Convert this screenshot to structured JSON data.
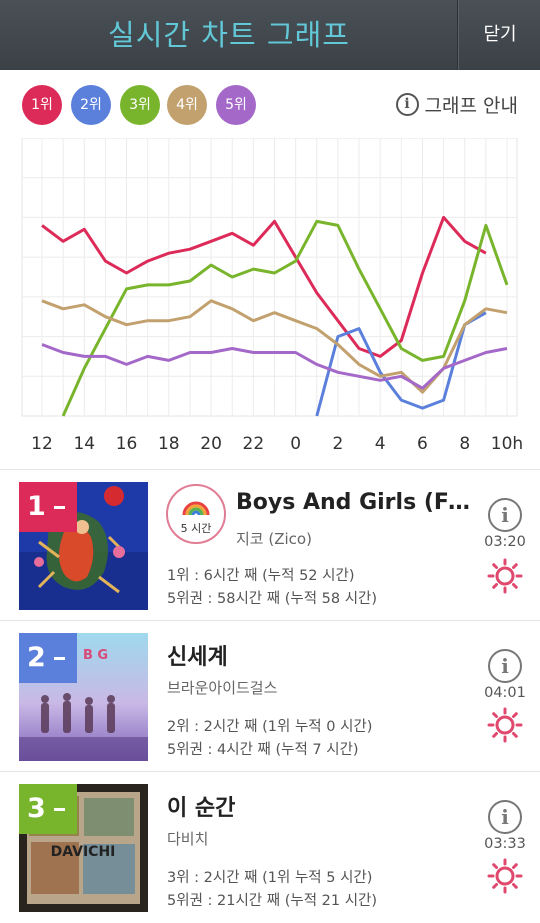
{
  "header": {
    "title": "실시간 차트 그래프",
    "close_label": "닫기"
  },
  "legend": {
    "items": [
      {
        "label": "1위",
        "color": "#dd2b59"
      },
      {
        "label": "2위",
        "color": "#5b80dc"
      },
      {
        "label": "3위",
        "color": "#79b52c"
      },
      {
        "label": "4위",
        "color": "#c2a16e"
      },
      {
        "label": "5위",
        "color": "#a468c8"
      }
    ],
    "guide_label": "그래프 안내"
  },
  "chart_data": {
    "type": "line",
    "x": [
      "12",
      "13",
      "14",
      "15",
      "16",
      "17",
      "18",
      "19",
      "20",
      "21",
      "22",
      "23",
      "0",
      "1",
      "2",
      "3",
      "4",
      "5",
      "6",
      "7",
      "8",
      "9",
      "10h"
    ],
    "tick_labels": [
      "12",
      "14",
      "16",
      "18",
      "20",
      "22",
      "0",
      "2",
      "4",
      "6",
      "8",
      "10h"
    ],
    "ylim": [
      7,
      0
    ],
    "grid": true,
    "series": [
      {
        "rank": 1,
        "color": "#dd2b59",
        "values": [
          2.2,
          2.6,
          2.3,
          3.1,
          3.4,
          3.1,
          2.9,
          2.8,
          2.6,
          2.4,
          2.7,
          2.1,
          3.0,
          3.9,
          4.6,
          5.3,
          5.5,
          5.1,
          3.4,
          2.0,
          2.6,
          2.9,
          null
        ]
      },
      {
        "rank": 2,
        "color": "#5b80dc",
        "values": [
          null,
          null,
          null,
          null,
          null,
          null,
          null,
          null,
          null,
          null,
          null,
          null,
          null,
          7.0,
          5.0,
          4.8,
          5.9,
          6.6,
          6.8,
          6.6,
          4.7,
          4.4,
          null
        ]
      },
      {
        "rank": 3,
        "color": "#79b52c",
        "values": [
          null,
          7.0,
          5.8,
          4.8,
          3.8,
          3.7,
          3.7,
          3.6,
          3.2,
          3.5,
          3.3,
          3.4,
          3.1,
          2.1,
          2.2,
          3.3,
          4.3,
          5.3,
          5.6,
          5.5,
          4.1,
          2.2,
          3.7
        ]
      },
      {
        "rank": 4,
        "color": "#c2a16e",
        "values": [
          4.1,
          4.3,
          4.2,
          4.5,
          4.7,
          4.6,
          4.6,
          4.5,
          4.1,
          4.3,
          4.6,
          4.4,
          4.6,
          4.8,
          5.2,
          5.7,
          6.0,
          5.9,
          6.4,
          5.8,
          4.7,
          4.3,
          4.4
        ]
      },
      {
        "rank": 5,
        "color": "#a468c8",
        "values": [
          5.2,
          5.4,
          5.5,
          5.5,
          5.7,
          5.5,
          5.6,
          5.4,
          5.4,
          5.3,
          5.4,
          5.4,
          5.4,
          5.7,
          5.9,
          6.0,
          6.1,
          6.0,
          6.3,
          5.8,
          5.6,
          5.4,
          5.3
        ]
      }
    ]
  },
  "songs": [
    {
      "rank": "1",
      "badge_color": "#dd2b59",
      "title": "Boys And Girls (Feat. Babylon)",
      "artist": "지코 (Zico)",
      "stat1": "1위 : 6시간 째 (누적 52 시간)",
      "stat2": "5위권 : 58시간 째 (누적 58 시간)",
      "duration": "03:20",
      "hours_badge": "5 시간"
    },
    {
      "rank": "2",
      "badge_color": "#5b80dc",
      "title": "신세계",
      "artist": "브라운아이드걸스",
      "stat1": "2위 : 2시간 째 (1위 누적 0 시간)",
      "stat2": "5위권 : 4시간 째 (누적 7 시간)",
      "duration": "04:01"
    },
    {
      "rank": "3",
      "badge_color": "#79b52c",
      "title": "이 순간",
      "artist": "다비치",
      "stat1": "3위 : 2시간 째 (1위 누적 5 시간)",
      "stat2": "5위권 : 21시간 째 (누적 21 시간)",
      "duration": "03:33"
    }
  ],
  "album_art": {
    "album_1": "red figure collage on blue",
    "album_2": "B G",
    "album_3": "DAVICHI"
  }
}
